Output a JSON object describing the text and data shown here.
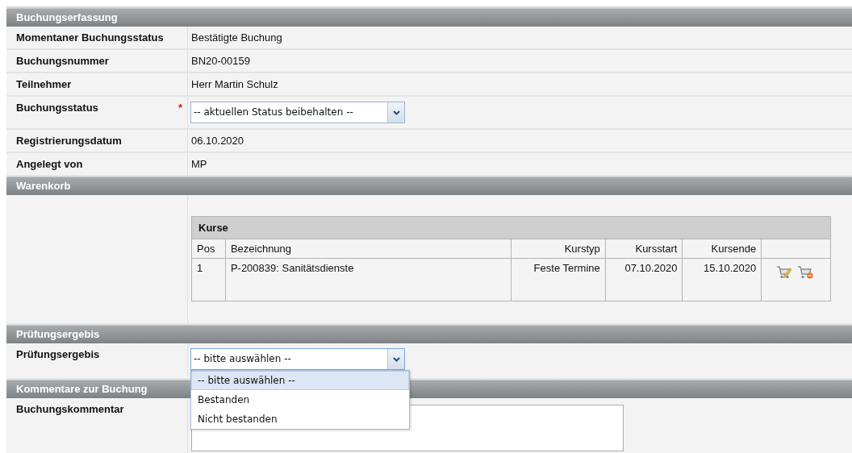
{
  "sections": [
    {
      "title": "Buchungserfassung",
      "rows": [
        {
          "kind": "text",
          "label": "Momentaner Buchungsstatus",
          "value": "Bestätigte Buchung"
        },
        {
          "kind": "text",
          "label": "Buchungsnummer",
          "value": "BN20-00159"
        },
        {
          "kind": "text",
          "label": "Teilnehmer",
          "value": "Herr Martin Schulz"
        },
        {
          "kind": "select",
          "label": "Buchungsstatus",
          "required_mark": "*",
          "value": "-- aktuellen Status beibehalten --"
        },
        {
          "kind": "text",
          "label": "Registrierungsdatum",
          "value": "06.10.2020"
        },
        {
          "kind": "text",
          "label": "Angelegt von",
          "value": "MP"
        }
      ]
    },
    {
      "title": "Warenkorb",
      "rows": [
        {
          "kind": "courses",
          "courses": {
            "title": "Kurse",
            "columns": [
              {
                "label": "Pos"
              },
              {
                "label": "Bezeichnung"
              },
              {
                "label": "Kurstyp"
              },
              {
                "label": "Kursstart"
              },
              {
                "label": "Kursende"
              }
            ],
            "rows": [
              {
                "cells": [
                  "1",
                  "P-200839: Sanitätsdienste",
                  "Feste Termine",
                  "07.10.2020",
                  "15.10.2020"
                ]
              }
            ]
          }
        }
      ]
    },
    {
      "title": "Prüfungsergebis",
      "rows": [
        {
          "kind": "select",
          "label": "Prüfungsergebis",
          "value": "-- bitte auswählen --",
          "open": true,
          "options": [
            {
              "label": "-- bitte auswählen --",
              "selected": true
            },
            {
              "label": "Bestanden",
              "selected": false
            },
            {
              "label": "Nicht bestanden",
              "selected": false
            }
          ]
        }
      ]
    },
    {
      "title": "Kommentare zur Buchung",
      "rows": [
        {
          "kind": "textarea",
          "label": "Buchungskommentar"
        }
      ]
    }
  ]
}
